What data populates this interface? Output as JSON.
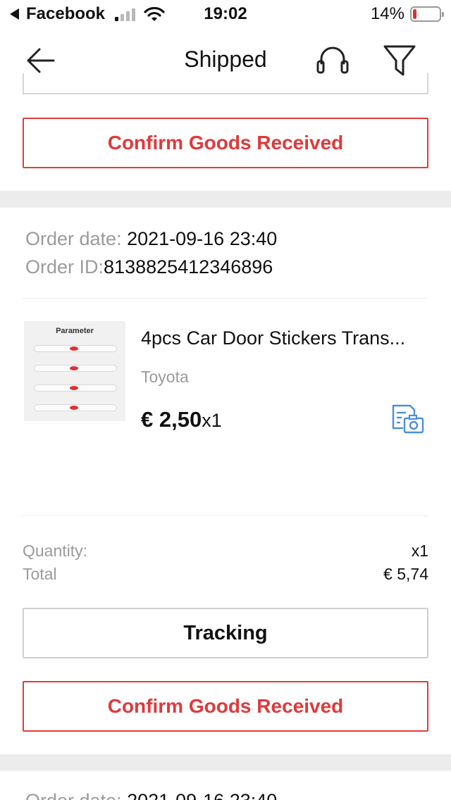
{
  "status_bar": {
    "back_app": "Facebook",
    "time": "19:02",
    "battery_percent": "14%",
    "battery_level": 0.14,
    "battery_color": "#e62b2b"
  },
  "nav": {
    "title": "Shipped",
    "back_icon": "arrow-left-icon",
    "support_icon": "headset-icon",
    "filter_icon": "funnel-icon"
  },
  "previous_order": {
    "confirm_label": "Confirm Goods Received"
  },
  "order": {
    "date_label": "Order date: ",
    "date_value": "2021-09-16 23:40",
    "id_label": "Order ID:",
    "id_value": "8138825412346896",
    "item": {
      "thumbnail_heading": "Parameter",
      "title": "4pcs Car Door Stickers Trans...",
      "variant": "Toyota",
      "price": "€ 2,50",
      "qty": "x1",
      "review_icon": "photo-review-icon"
    },
    "quantity_label": "Quantity:",
    "quantity_value": "x1",
    "total_label": "Total",
    "total_value": "€ 5,74",
    "tracking_label": "Tracking",
    "confirm_label": "Confirm Goods Received"
  },
  "next_order": {
    "date_label": "Order date: ",
    "date_value": "2021-09-16 23:40"
  },
  "colors": {
    "accent_red": "#e0393b",
    "divider": "#ececec",
    "muted_text": "#9b9b9b",
    "icon_blue": "#4a90d9"
  }
}
